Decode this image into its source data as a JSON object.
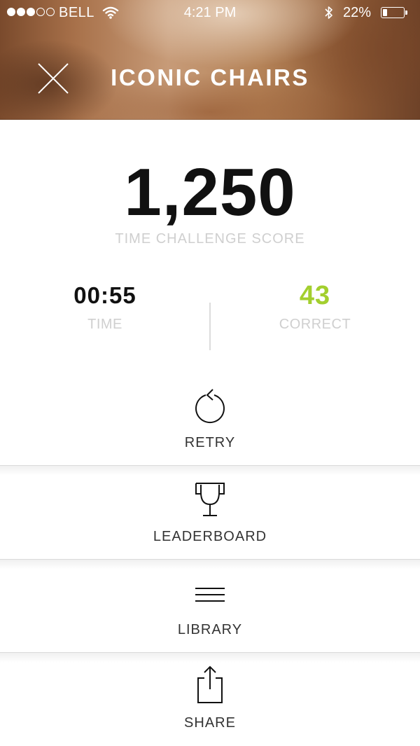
{
  "status_bar": {
    "carrier": "BELL",
    "time": "4:21 PM",
    "battery": "22%",
    "battery_level": 0.22,
    "signal_bars_filled": 3,
    "signal_bars_total": 5
  },
  "header": {
    "title": "ICONIC CHAIRS",
    "close_icon": "close-icon"
  },
  "score": {
    "value": "1,250",
    "label": "TIME CHALLENGE SCORE"
  },
  "stats": {
    "time": {
      "value": "00:55",
      "label": "TIME"
    },
    "correct": {
      "value": "43",
      "label": "CORRECT"
    }
  },
  "actions": [
    {
      "label": "RETRY",
      "icon": "retry-icon"
    },
    {
      "label": "LEADERBOARD",
      "icon": "trophy-icon"
    },
    {
      "label": "LIBRARY",
      "icon": "menu-icon"
    },
    {
      "label": "SHARE",
      "icon": "share-icon"
    }
  ],
  "colors": {
    "accent_green": "#a3cf2e",
    "muted_text": "#cfcfcf"
  }
}
